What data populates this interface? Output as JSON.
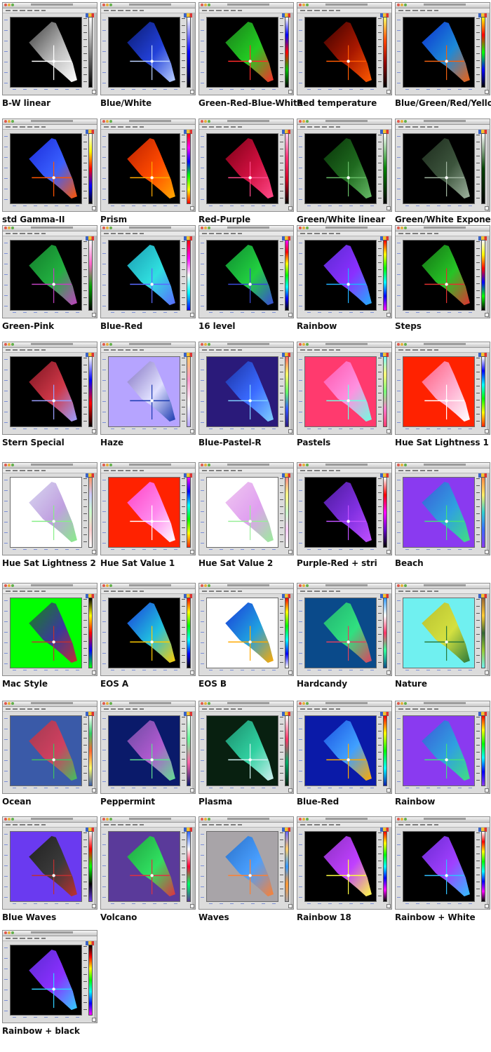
{
  "colormaps": [
    {
      "name": "B-W linear",
      "bg": "#000000",
      "bar": [
        "#000000",
        "#ffffff"
      ],
      "sp": [
        "#3a3a3a",
        "#bdbdbd",
        "#ffffff"
      ]
    },
    {
      "name": "Blue/White",
      "bg": "#000000",
      "bar": [
        "#000000",
        "#0000ff",
        "#ffffff"
      ],
      "sp": [
        "#0a1a6e",
        "#2240d8",
        "#bcd2ff"
      ]
    },
    {
      "name": "Green-Red-Blue-White",
      "bg": "#000000",
      "bar": [
        "#000000",
        "#00c000",
        "#ff0000",
        "#0000ff",
        "#ffffff"
      ],
      "sp": [
        "#1a7a1a",
        "#22cc22",
        "#ff2a2a"
      ]
    },
    {
      "name": "Red temperature",
      "bg": "#000000",
      "bar": [
        "#000000",
        "#8b0000",
        "#ff4400",
        "#ffff66"
      ],
      "sp": [
        "#3a0000",
        "#a81800",
        "#ff5a00"
      ]
    },
    {
      "name": "Blue/Green/Red/Yellow",
      "bg": "#000000",
      "bar": [
        "#000000",
        "#0000ff",
        "#00ff00",
        "#ff0000",
        "#ffff00"
      ],
      "sp": [
        "#0c2fd0",
        "#1d8ad8",
        "#f06010"
      ]
    },
    {
      "name": "std Gamma-II",
      "bg": "#000000",
      "bar": [
        "#000000",
        "#0000ff",
        "#ff0000",
        "#ffff00",
        "#ffffff"
      ],
      "sp": [
        "#1a2ad8",
        "#3a60ff",
        "#ff5500"
      ]
    },
    {
      "name": "Prism",
      "bg": "#000000",
      "bar": [
        "#ff0000",
        "#ffff00",
        "#00ff00",
        "#0000ff",
        "#ff00ff",
        "#ff0000"
      ],
      "sp": [
        "#b82000",
        "#ff4a00",
        "#ffaa00"
      ]
    },
    {
      "name": "Red-Purple",
      "bg": "#000000",
      "bar": [
        "#000000",
        "#cc0022",
        "#ff3377",
        "#ffccee"
      ],
      "sp": [
        "#7a0015",
        "#d01040",
        "#ff4a8a"
      ]
    },
    {
      "name": "Green/White linear",
      "bg": "#000000",
      "bar": [
        "#000000",
        "#008000",
        "#ffffff"
      ],
      "sp": [
        "#083308",
        "#1f6a1f",
        "#66bb66"
      ]
    },
    {
      "name": "Green/White Exponen.",
      "bg": "#000000",
      "bar": [
        "#000000",
        "#004000",
        "#ffffff"
      ],
      "sp": [
        "#1c2a1c",
        "#3d553d",
        "#a0b4a0"
      ]
    },
    {
      "name": "Green-Pink",
      "bg": "#000000",
      "bar": [
        "#000000",
        "#00a000",
        "#ff66cc",
        "#ffffff"
      ],
      "sp": [
        "#127a2a",
        "#22b040",
        "#c040c0"
      ]
    },
    {
      "name": "Blue-Red",
      "bg": "#000000",
      "bar": [
        "#0000ff",
        "#00ffff",
        "#ffffff",
        "#ff00ff",
        "#ff0000"
      ],
      "sp": [
        "#1a9ab0",
        "#30e0e0",
        "#5a6aff"
      ]
    },
    {
      "name": "16 level",
      "bg": "#000000",
      "bar": [
        "#000000",
        "#0000ff",
        "#00ffff",
        "#00ff00",
        "#ffff00",
        "#ff0000",
        "#ff00ff"
      ],
      "sp": [
        "#0e8a30",
        "#22d040",
        "#3a4ad8"
      ]
    },
    {
      "name": "Rainbow",
      "bg": "#000000",
      "bar": [
        "#ff00ff",
        "#0000ff",
        "#00ffff",
        "#00ff00",
        "#ffff00",
        "#ff0000"
      ],
      "sp": [
        "#5a2ad0",
        "#8a30ff",
        "#20b0ff"
      ]
    },
    {
      "name": "Steps",
      "bg": "#000000",
      "bar": [
        "#000000",
        "#00ff00",
        "#0000ff",
        "#ff0000",
        "#ffff00",
        "#ffffff"
      ],
      "sp": [
        "#147014",
        "#26c426",
        "#e03030"
      ]
    },
    {
      "name": "Stern Special",
      "bg": "#000000",
      "bar": [
        "#000000",
        "#ff0000",
        "#0000ff",
        "#ffffff"
      ],
      "sp": [
        "#7a1420",
        "#d03848",
        "#9aa0ff"
      ]
    },
    {
      "name": "Haze",
      "bg": "#b6a4ff",
      "bar": [
        "#b6a4ff",
        "#ffffff",
        "#ff99cc",
        "#ffcc66"
      ],
      "sp": [
        "#8070c0",
        "#e0e0ff",
        "#1a3ab0"
      ]
    },
    {
      "name": "Blue-Pastel-R",
      "bg": "#2a1a7a",
      "bar": [
        "#2a1a7a",
        "#3355ff",
        "#66ff66",
        "#ffff66",
        "#ff6666"
      ],
      "sp": [
        "#1a30a0",
        "#3a6aff",
        "#80d0ff"
      ]
    },
    {
      "name": "Pastels",
      "bg": "#ff3a6e",
      "bar": [
        "#ff3a6e",
        "#ff77cc",
        "#77ff77",
        "#ffff77",
        "#77ffff"
      ],
      "sp": [
        "#ff55aa",
        "#ff90e0",
        "#70ffe0"
      ]
    },
    {
      "name": "Hue Sat Lightness 1",
      "bg": "#ff2200",
      "bar": [
        "#ff2200",
        "#ffff00",
        "#00ff00",
        "#00ffff",
        "#0000ff",
        "#ffffff"
      ],
      "sp": [
        "#ff5a7a",
        "#ffb0d0",
        "#ffffff"
      ]
    },
    {
      "name": "Hue Sat Lightness 2",
      "bg": "#ffffff",
      "bar": [
        "#ffffff",
        "#ffcccc",
        "#ccffcc",
        "#ccccff",
        "#ff9966"
      ],
      "sp": [
        "#d8d8f0",
        "#c0a0e0",
        "#88ee88"
      ]
    },
    {
      "name": "Hue Sat Value 1",
      "bg": "#ff2200",
      "bar": [
        "#ff2200",
        "#ffff00",
        "#00ff00",
        "#00ffff",
        "#0000ff",
        "#ff00ff"
      ],
      "sp": [
        "#ff40c0",
        "#ff88ee",
        "#ffffff"
      ]
    },
    {
      "name": "Hue Sat Value 2",
      "bg": "#ffffff",
      "bar": [
        "#ffffff",
        "#ffccff",
        "#ccffcc",
        "#ffff88",
        "#ff8888"
      ],
      "sp": [
        "#f0c8f0",
        "#e0a0f0",
        "#99ee99"
      ]
    },
    {
      "name": "Purple-Red + stri",
      "bg": "#000000",
      "bar": [
        "#000000",
        "#6600cc",
        "#ff00ff",
        "#ff0000",
        "#ffffff"
      ],
      "sp": [
        "#4a1a9a",
        "#8030e0",
        "#c050ff"
      ]
    },
    {
      "name": "Beach",
      "bg": "#8a3af0",
      "bar": [
        "#8a3af0",
        "#3a6aff",
        "#30d0d0",
        "#ffee66",
        "#ff8844"
      ],
      "sp": [
        "#3a5ad8",
        "#30a0e0",
        "#40e080"
      ]
    },
    {
      "name": "Mac Style",
      "bg": "#00ff00",
      "bar": [
        "#00ff00",
        "#0000ff",
        "#ff0000",
        "#ffff00",
        "#000000"
      ],
      "sp": [
        "#138a13",
        "#3a3a9a",
        "#c03030"
      ]
    },
    {
      "name": "EOS A",
      "bg": "#000000",
      "bar": [
        "#000000",
        "#0000ff",
        "#00ffff",
        "#00ff00",
        "#ffff00",
        "#ff0000"
      ],
      "sp": [
        "#1a3ad8",
        "#20c0e0",
        "#ffcc00"
      ]
    },
    {
      "name": "EOS B",
      "bg": "#ffffff",
      "bar": [
        "#ffffff",
        "#0000ff",
        "#00ffff",
        "#00ff00",
        "#ffff00",
        "#ff0000"
      ],
      "sp": [
        "#1a3ad8",
        "#20a0e0",
        "#ffaa00"
      ]
    },
    {
      "name": "Hardcandy",
      "bg": "#0a4a8a",
      "bar": [
        "#0a4a8a",
        "#33ff99",
        "#ff3366",
        "#ffffff",
        "#3399ff"
      ],
      "sp": [
        "#22b070",
        "#30e080",
        "#e04060"
      ]
    },
    {
      "name": "Nature",
      "bg": "#70f0f0",
      "bar": [
        "#70f0f0",
        "#99cc33",
        "#336633",
        "#ffcc33",
        "#996633"
      ],
      "sp": [
        "#b8c030",
        "#d4e040",
        "#2a7a3a"
      ]
    },
    {
      "name": "Ocean",
      "bg": "#3a5aa8",
      "bar": [
        "#3a5aa8",
        "#ffff66",
        "#ff6633",
        "#33cc66",
        "#ffffff"
      ],
      "sp": [
        "#a03a50",
        "#d04060",
        "#40c060"
      ]
    },
    {
      "name": "Peppermint",
      "bg": "#0a1a6a",
      "bar": [
        "#0a1a6a",
        "#ff66aa",
        "#66ff99",
        "#ffffff"
      ],
      "sp": [
        "#6a4aa0",
        "#b05ad0",
        "#60e090"
      ]
    },
    {
      "name": "Plasma",
      "bg": "#082010",
      "bar": [
        "#082010",
        "#00aa66",
        "#ff3366",
        "#ffffff"
      ],
      "sp": [
        "#1a8a6a",
        "#30d0a0",
        "#d0f0f0"
      ]
    },
    {
      "name": "Blue-Red",
      "bg": "#0a1aa8",
      "bar": [
        "#0a1aa8",
        "#00ffff",
        "#00ff00",
        "#ffff00",
        "#ff0000"
      ],
      "sp": [
        "#1a50e0",
        "#40a0ff",
        "#ffaa00"
      ]
    },
    {
      "name": "Rainbow",
      "bg": "#8a3af0",
      "bar": [
        "#8a3af0",
        "#0000ff",
        "#00ffff",
        "#00ff00",
        "#ffff00",
        "#ff0000"
      ],
      "sp": [
        "#3a5ad8",
        "#30a0e0",
        "#40e080"
      ]
    },
    {
      "name": "Blue Waves",
      "bg": "#6a3af0",
      "bar": [
        "#6a3af0",
        "#000000",
        "#00ff00",
        "#ff0000",
        "#ffffff"
      ],
      "sp": [
        "#202020",
        "#3a3a3a",
        "#c03030"
      ]
    },
    {
      "name": "Volcano",
      "bg": "#5a3a9a",
      "bar": [
        "#5a3a9a",
        "#00ff66",
        "#ff0033",
        "#ffffff",
        "#3366ff"
      ],
      "sp": [
        "#20a040",
        "#30e060",
        "#e03040"
      ]
    },
    {
      "name": "Waves",
      "bg": "#a8a4a8",
      "bar": [
        "#a8a4a8",
        "#ff9933",
        "#3399ff",
        "#ffcc66",
        "#6666ff"
      ],
      "sp": [
        "#2a70c8",
        "#4aa0ff",
        "#ff8030"
      ]
    },
    {
      "name": "Rainbow 18",
      "bg": "#000000",
      "bar": [
        "#000000",
        "#ff00ff",
        "#0000ff",
        "#00ffff",
        "#00ff00",
        "#ffff00",
        "#ff0000"
      ],
      "sp": [
        "#8a30c0",
        "#c040ff",
        "#ffff40"
      ]
    },
    {
      "name": "Rainbow + White",
      "bg": "#000000",
      "bar": [
        "#000000",
        "#ff00ff",
        "#0000ff",
        "#00ffff",
        "#00ff00",
        "#ffff00",
        "#ff0000",
        "#ffffff"
      ],
      "sp": [
        "#6a2ad0",
        "#a040ff",
        "#30c0ff"
      ]
    },
    {
      "name": "Rainbow + black",
      "bg": "#000000",
      "bar": [
        "#ff00ff",
        "#0000ff",
        "#00ffff",
        "#00ff00",
        "#ffff00",
        "#ff0000",
        "#000000"
      ],
      "sp": [
        "#5a2ad0",
        "#8a30ff",
        "#30d0ff"
      ]
    }
  ]
}
